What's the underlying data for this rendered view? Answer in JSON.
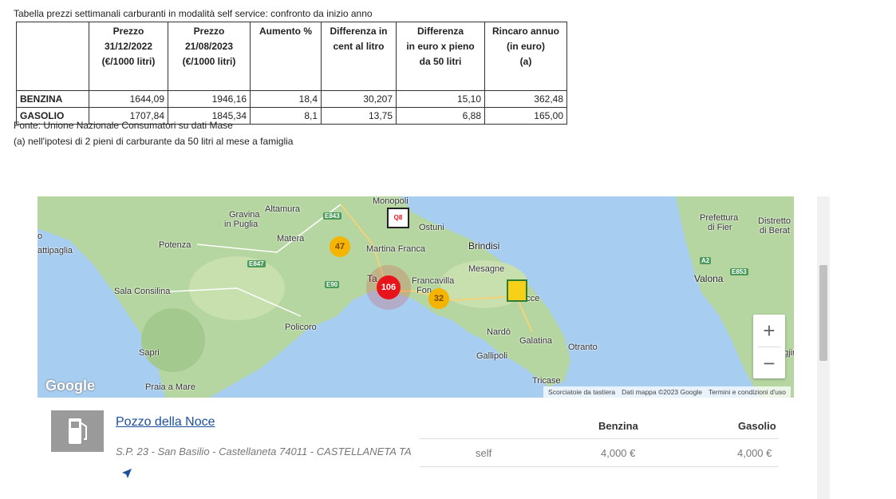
{
  "table": {
    "caption": "Tabella prezzi settimanali carburanti in modalità self service: confronto da inizio anno",
    "headers": [
      {
        "lines": []
      },
      {
        "lines": [
          "Prezzo",
          "31/12/2022",
          "(€/1000 litri)"
        ]
      },
      {
        "lines": [
          "Prezzo",
          "21/08/2023",
          "(€/1000 litri)"
        ]
      },
      {
        "lines": [
          "Aumento %"
        ]
      },
      {
        "lines": [
          "Differenza in",
          "cent al litro"
        ]
      },
      {
        "lines": [
          "Differenza",
          "in euro x pieno",
          "da 50 litri"
        ]
      },
      {
        "lines": [
          "Rincaro annuo",
          "(in euro)",
          "(a)"
        ]
      }
    ],
    "rows": [
      {
        "label": "BENZINA",
        "values": [
          "1644,09",
          "1946,16",
          "18,4",
          "30,207",
          "15,10",
          "362,48"
        ]
      },
      {
        "label": "GASOLIO",
        "values": [
          "1707,84",
          "1845,34",
          "8,1",
          "13,75",
          "6,88",
          "165,00"
        ]
      }
    ],
    "source": "Fonte: Unione Nazionale Consumatori su dati Mase",
    "footnote": "(a) nell'ipotesi di 2 pieni di carburante da 50 litri al mese a famiglia"
  },
  "map": {
    "places": {
      "monopoli": "Monopoli",
      "altamura": "Altamura",
      "gravina": "Gravina",
      "in_puglia": "in Puglia",
      "matera": "Matera",
      "potenza": "Potenza",
      "battipaglia": "attipaglia",
      "ostuni": "Ostuni",
      "brindisi": "Brindisi",
      "martina_franca": "Martina Franca",
      "mesagne": "Mesagne",
      "francavilla": "Francavilla",
      "fontana": "Fon",
      "taranto": "Ta",
      "lecce": "Lecce",
      "sala_consilina": "Sala Consilina",
      "policoro": "Policoro",
      "sapri": "Sapri",
      "praia": "Praia a Mare",
      "nardo": "Nardò",
      "galatina": "Galatina",
      "otranto": "Otranto",
      "gallipoli": "Gallipoli",
      "tricase": "Tricase",
      "prefettura": "Prefettura",
      "di_fier": "di Fier",
      "distretto": "Distretto",
      "di_berat": "di Berat",
      "valona": "Valona",
      "edge_o": "o",
      "edge_gjir": "gjir"
    },
    "roads": [
      "E843",
      "E847",
      "E90",
      "A2",
      "E853"
    ],
    "clusters": [
      {
        "count": "47",
        "color": "#f4b400"
      },
      {
        "count": "106",
        "color": "#e8141b"
      },
      {
        "count": "32",
        "color": "#f4b400"
      }
    ],
    "brand_mark": "Q8",
    "zoom_in": "+",
    "zoom_out": "−",
    "google_logo": "Google",
    "attribution": {
      "shortcuts": "Scorciatoie da tastiera",
      "data": "Dati mappa ©2023 Google",
      "terms": "Termini e condizioni d'uso"
    }
  },
  "station": {
    "name": "Pozzo della Noce",
    "address": "S.P. 23 - San Basilio - Castellaneta 74011 - CASTELLANETA TA",
    "col_benzina": "Benzina",
    "col_gasolio": "Gasolio",
    "mode": "self",
    "price_benzina": "4,000 €",
    "price_gasolio": "4,000 €"
  }
}
